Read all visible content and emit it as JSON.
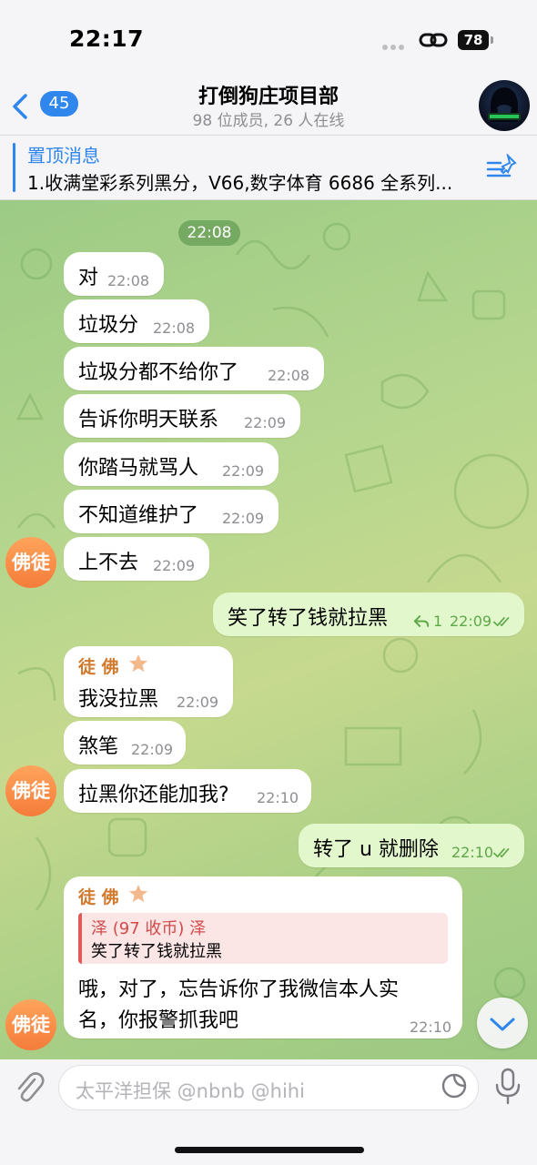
{
  "status_bar": {
    "time": "22:17",
    "battery": "78"
  },
  "header": {
    "back_count": "45",
    "title": "打倒狗庄项目部",
    "subtitle": "98 位成员, 26 人在线"
  },
  "pinned": {
    "title": "置顶消息",
    "text": "1.收满堂彩系列黑分，V66,数字体育 6686 全系列..."
  },
  "date_pill": "22:08",
  "messages": [
    {
      "text": "对",
      "time": "22:08"
    },
    {
      "text": "垃圾分",
      "time": "22:08"
    },
    {
      "text": "垃圾分都不给你了",
      "time": "22:08"
    },
    {
      "text": "告诉你明天联系",
      "time": "22:09"
    },
    {
      "text": "你踏马就骂人",
      "time": "22:09"
    },
    {
      "text": "不知道维护了",
      "time": "22:09"
    },
    {
      "text": "上不去",
      "time": "22:09"
    },
    {
      "text": "笑了转了钱就拉黑",
      "time": "22:09",
      "reply_count": "1"
    },
    {
      "sender": "徒 佛",
      "text": "我没拉黑",
      "time": "22:09"
    },
    {
      "text": "煞笔",
      "time": "22:09"
    },
    {
      "text": "拉黑你还能加我?",
      "time": "22:10"
    },
    {
      "text": "转了 u 就删除",
      "time": "22:10"
    },
    {
      "sender": "徒 佛",
      "reply_name": "泽 (97 收币) 泽",
      "reply_text": "笑了转了钱就拉黑",
      "text_line1": "哦，对了，忘告诉你了我微信本人实",
      "text_line2": "名，你报警抓我吧",
      "time": "22:10"
    }
  ],
  "avatars": {
    "user_label": "佛徒"
  },
  "input": {
    "placeholder": "太平洋担保 @nbnb @hihi"
  },
  "colors": {
    "accent": "#2f86ec",
    "sender": "#d07a2e",
    "avatar": "#f57c3a",
    "outgoing_bubble": "#e2f7cb"
  }
}
